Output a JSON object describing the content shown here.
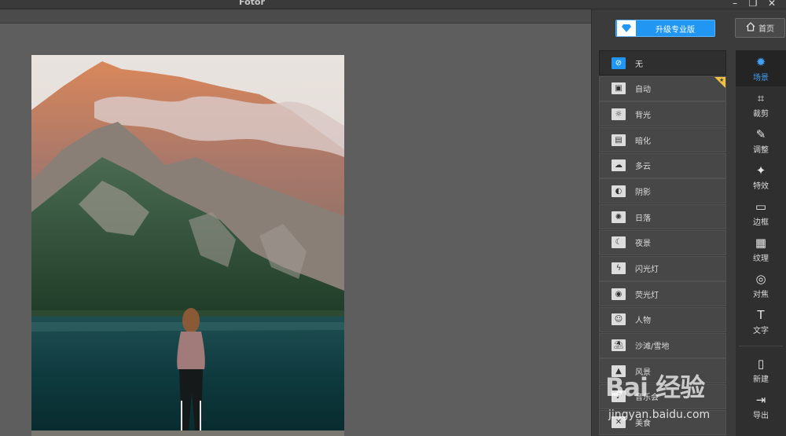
{
  "window": {
    "title": "Fotor",
    "minimize": "–",
    "restore": "❐",
    "close": "✕"
  },
  "header": {
    "upgrade_label": "升级专业版",
    "home_label": "首页"
  },
  "scenes": [
    {
      "label": "无",
      "icon": "no-icon",
      "glyph": "⊘",
      "selected": true
    },
    {
      "label": "自动",
      "icon": "camera-icon",
      "glyph": "▣",
      "badge": "pro-badge"
    },
    {
      "label": "背光",
      "icon": "backlight-icon",
      "glyph": "☼"
    },
    {
      "label": "暗化",
      "icon": "darken-icon",
      "glyph": "▤"
    },
    {
      "label": "多云",
      "icon": "cloud-icon",
      "glyph": "☁"
    },
    {
      "label": "阴影",
      "icon": "shadow-icon",
      "glyph": "◐"
    },
    {
      "label": "日落",
      "icon": "sunset-icon",
      "glyph": "✺"
    },
    {
      "label": "夜景",
      "icon": "night-icon",
      "glyph": "☾"
    },
    {
      "label": "闪光灯",
      "icon": "flash-icon",
      "glyph": "ϟ"
    },
    {
      "label": "荧光灯",
      "icon": "fluorescent-icon",
      "glyph": "◉"
    },
    {
      "label": "人物",
      "icon": "person-icon",
      "glyph": "☺"
    },
    {
      "label": "沙滩/雪地",
      "icon": "beach-icon",
      "glyph": "⛱"
    },
    {
      "label": "风景",
      "icon": "landscape-icon",
      "glyph": "▲"
    },
    {
      "label": "音乐会",
      "icon": "concert-icon",
      "glyph": "♪"
    },
    {
      "label": "美食",
      "icon": "food-icon",
      "glyph": "✕"
    }
  ],
  "tools": [
    {
      "label": "场景",
      "icon": "sun-icon",
      "glyph": "✹",
      "active": true
    },
    {
      "label": "裁剪",
      "icon": "crop-icon",
      "glyph": "⌗"
    },
    {
      "label": "调整",
      "icon": "pencil-icon",
      "glyph": "✎"
    },
    {
      "label": "特效",
      "icon": "sparkle-icon",
      "glyph": "✦"
    },
    {
      "label": "边框",
      "icon": "frame-icon",
      "glyph": "▭"
    },
    {
      "label": "纹理",
      "icon": "texture-icon",
      "glyph": "▦"
    },
    {
      "label": "对焦",
      "icon": "focus-icon",
      "glyph": "◎"
    },
    {
      "label": "文字",
      "icon": "text-icon",
      "glyph": "T"
    },
    {
      "label": "新建",
      "icon": "new-file-icon",
      "glyph": "▯"
    },
    {
      "label": "导出",
      "icon": "export-icon",
      "glyph": "⇥"
    }
  ],
  "watermark": {
    "brand": "Bai 经验",
    "url": "jingyan.baidu.com"
  },
  "colors": {
    "accent": "#2196f3",
    "sidebar_bg": "#3b3b3b",
    "canvas_bg": "#5e5e5e"
  }
}
